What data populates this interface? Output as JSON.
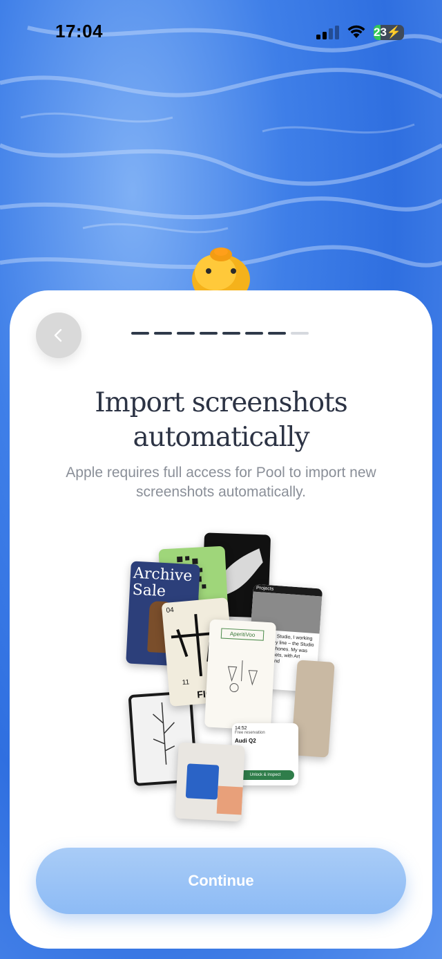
{
  "status_bar": {
    "time": "17:04",
    "battery_percent": "23",
    "battery_level": 0.23,
    "signal_icon": "cellular-signal-icon",
    "wifi_icon": "wifi-icon"
  },
  "onboarding": {
    "progress": {
      "total_steps": 8,
      "current_step": 7
    },
    "title_line1": "Import screenshots",
    "title_line2": "automatically",
    "subtitle": "Apple requires full access for Pool to import new screenshots automatically.",
    "continue_label": "Continue",
    "back_icon": "chevron-left-icon"
  },
  "collage": {
    "cards": [
      {
        "name": "archive-sale-card",
        "text_line1": "Archive",
        "text_line2": "Sale"
      },
      {
        "name": "poster-card",
        "text_top": "04",
        "text_bottom": "11",
        "text_footer": "FIG"
      },
      {
        "name": "aperitivoo-card",
        "label": "AperitiVoo"
      },
      {
        "name": "projects-card",
        "tab": "Projects",
        "text": "Homeform Studio, I working on Beats by line – the Studio Pro Headphones. My was various facets, with Art Direction and"
      },
      {
        "name": "car-card",
        "time": "14:52",
        "line1": "Free reservation",
        "model": "Audi Q2",
        "button": "Unlock & inspect"
      }
    ]
  },
  "colors": {
    "accent": "#8dbbf5",
    "title": "#2c3344",
    "subtitle": "#8a8f98"
  }
}
